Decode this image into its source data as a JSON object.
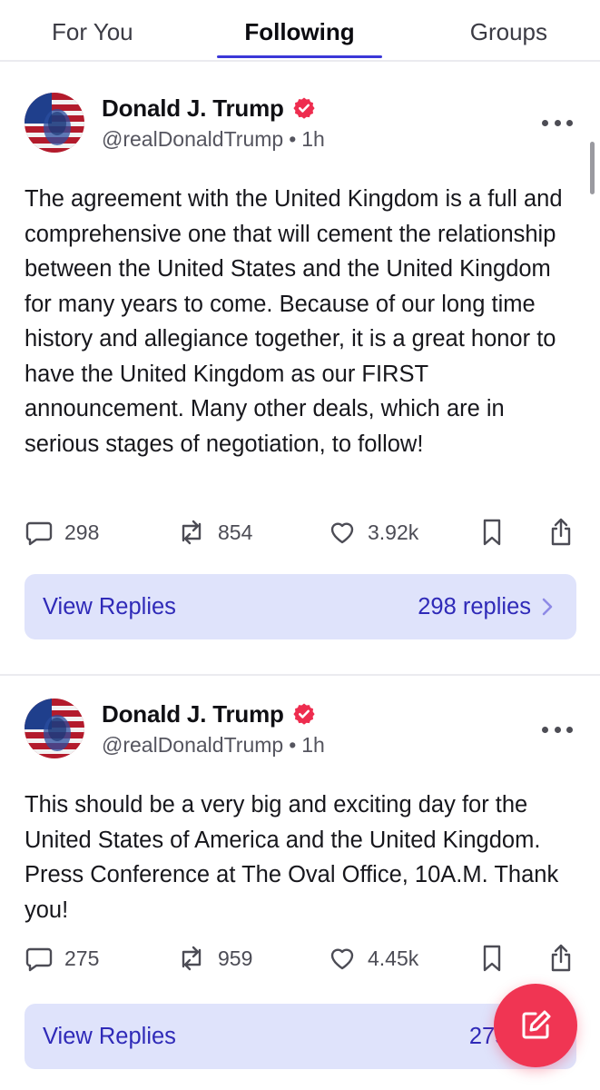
{
  "tabs": [
    {
      "label": "For You",
      "active": false
    },
    {
      "label": "Following",
      "active": true
    },
    {
      "label": "Groups",
      "active": false
    }
  ],
  "posts": [
    {
      "author": "Donald J. Trump",
      "handle": "@realDonaldTrump",
      "separator": "•",
      "time": "1h",
      "text": "The agreement with the United Kingdom is a full and comprehensive one that will cement the relationship between the United States and the United Kingdom for many years to come. Because of our long time history and allegiance together, it is a great honor to have the United Kingdom as our FIRST announcement. Many other deals, which are in serious stages of negotiation, to follow!",
      "replies_count": "298",
      "retruths_count": "854",
      "likes_count": "3.92k",
      "view_replies_label": "View Replies",
      "replies_summary": "298 replies"
    },
    {
      "author": "Donald J. Trump",
      "handle": "@realDonaldTrump",
      "separator": "•",
      "time": "1h",
      "text": "This should be a very big and exciting day for the United States of America and the United Kingdom. Press Conference at The Oval Office, 10A.M. Thank you!",
      "replies_count": "275",
      "retruths_count": "959",
      "likes_count": "4.45k",
      "view_replies_label": "View Replies",
      "replies_summary": "275 repl"
    }
  ],
  "icons": {
    "verified": "verified-badge-icon",
    "more": "more-horizontal-icon",
    "reply": "comment-bubble-icon",
    "retruth": "repost-icon",
    "like": "heart-icon",
    "bookmark": "bookmark-icon",
    "share": "share-icon",
    "compose": "compose-icon",
    "chevron": "chevron-right-icon"
  },
  "colors": {
    "accent": "#3b37d8",
    "replies_bar_bg": "#dfe3fb",
    "replies_bar_text": "#2f2ab8",
    "verified": "#ee2d4f",
    "fab": "#f03553"
  }
}
